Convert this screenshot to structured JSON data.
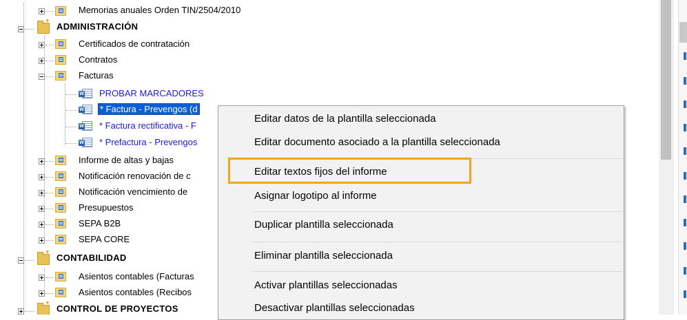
{
  "tree": {
    "top_item": "Memorias anuales Orden TIN/2504/2010",
    "sections": [
      {
        "label": "ADMINISTRACIÓN"
      },
      {
        "label": "CONTABILIDAD"
      },
      {
        "label": "CONTROL DE PROYECTOS"
      }
    ],
    "admin_items": [
      "Certificados de contratación",
      "Contratos",
      "Facturas",
      "Informe de altas y bajas",
      "Notificación renovación de c",
      "Notificación vencimiento de",
      "Presupuestos",
      "SEPA B2B",
      "SEPA CORE"
    ],
    "facturas_children": [
      "PROBAR MARCADORES",
      "* Factura - Prevengos (d",
      "* Factura rectificativa - F",
      "* Prefactura - Prevengos"
    ],
    "contabilidad_items": [
      "Asientos contables (Facturas",
      "Asientos contables (Recibos"
    ]
  },
  "context_menu": {
    "items": [
      "Editar datos de la plantilla seleccionada",
      "Editar documento asociado a la plantilla seleccionada",
      "Editar textos fijos del informe",
      "Asignar logotipo al informe",
      "Duplicar plantilla seleccionada",
      "Eliminar plantilla seleccionada",
      "Activar plantillas seleccionadas",
      "Desactivar plantillas seleccionadas"
    ],
    "highlighted_index": 2,
    "highlight_color": "#f5a21c"
  },
  "colors": {
    "selection": "#0a5fd8",
    "template_text": "#1a1aff"
  }
}
